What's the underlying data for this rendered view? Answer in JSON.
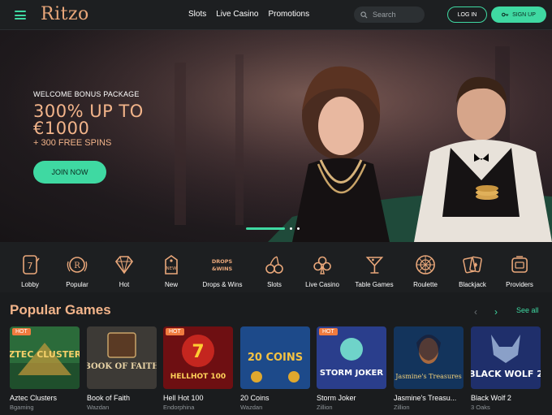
{
  "header": {
    "logo": "Ritzo",
    "nav": [
      "Slots",
      "Live Casino",
      "Promotions"
    ],
    "search_placeholder": "Search",
    "login_label": "LOG IN",
    "signup_label": "SIGN UP"
  },
  "hero": {
    "eyebrow": "WELCOME BONUS PACKAGE",
    "title_line1": "300% UP TO",
    "title_line2": "€1000",
    "spins": "+ 300 FREE SPINS",
    "cta": "JOIN NOW"
  },
  "categories": [
    {
      "label": "Lobby",
      "icon": "lobby-icon"
    },
    {
      "label": "Popular",
      "icon": "popular-icon"
    },
    {
      "label": "Hot",
      "icon": "diamond-icon"
    },
    {
      "label": "New",
      "icon": "new-tag-icon"
    },
    {
      "label": "Drops & Wins",
      "icon": "drops-wins-icon"
    },
    {
      "label": "Slots",
      "icon": "cherries-icon"
    },
    {
      "label": "Live Casino",
      "icon": "club-icon"
    },
    {
      "label": "Table Games",
      "icon": "cocktail-icon"
    },
    {
      "label": "Roulette",
      "icon": "roulette-icon"
    },
    {
      "label": "Blackjack",
      "icon": "cards-icon"
    },
    {
      "label": "Providers",
      "icon": "providers-icon"
    }
  ],
  "popular": {
    "title": "Popular Games",
    "see_all": "See all",
    "prev_arrow": "‹",
    "next_arrow": "›",
    "games": [
      {
        "name": "Aztec Clusters",
        "provider": "Bgaming",
        "hot": "HOT",
        "art": "AZTEC CLUSTERS"
      },
      {
        "name": "Book of Faith",
        "provider": "Wazdan",
        "hot": "",
        "art": "BOOK OF FAITH"
      },
      {
        "name": "Hell Hot 100",
        "provider": "Endorphina",
        "hot": "HOT",
        "art": "HELLHOT 100"
      },
      {
        "name": "20 Coins",
        "provider": "Wazdan",
        "hot": "",
        "art": "20 COINS"
      },
      {
        "name": "Storm Joker",
        "provider": "Zillion",
        "hot": "HOT",
        "art": "STORM JOKER"
      },
      {
        "name": "Jasmine's Treasu...",
        "provider": "Zillion",
        "hot": "",
        "art": "Jasmine's Treasures"
      },
      {
        "name": "Black Wolf 2",
        "provider": "3 Oaks",
        "hot": "",
        "art": "BLACK WOLF 2"
      }
    ]
  },
  "colors": {
    "accent": "#3fd9a2",
    "gold": "#f2b48a",
    "hot_badge": "#f07b3f",
    "bg": "#1a1c1e"
  }
}
